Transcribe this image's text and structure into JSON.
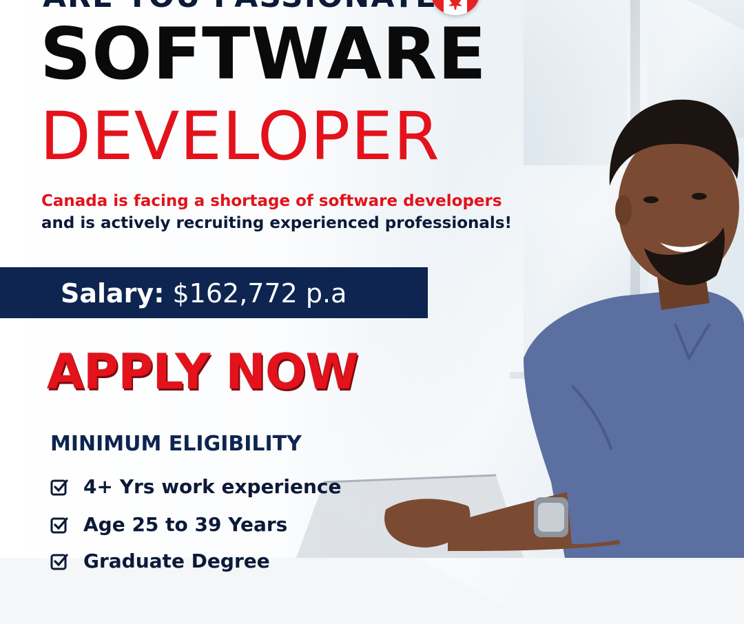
{
  "headline": {
    "top_cut": "ARE YOU PASSIONATE",
    "line1": "SOFTWARE",
    "line2": "DEVELOPER"
  },
  "subtitle": {
    "red": "Canada is facing a shortage of software developers",
    "navy": "and is actively recruiting experienced professionals!"
  },
  "salary": {
    "label": "Salary:",
    "value": "$162,772 p.a"
  },
  "cta": "APPLY NOW",
  "eligibility": {
    "title": "MINIMUM ELIGIBILITY",
    "items": [
      "4+ Yrs work experience",
      "Age 25 to 39 Years",
      "Graduate Degree"
    ]
  },
  "colors": {
    "red": "#e3121b",
    "navy": "#0d2550",
    "black": "#0a0a0a"
  },
  "icons": [
    "canada-flag-icon",
    "checkbox-icon"
  ]
}
